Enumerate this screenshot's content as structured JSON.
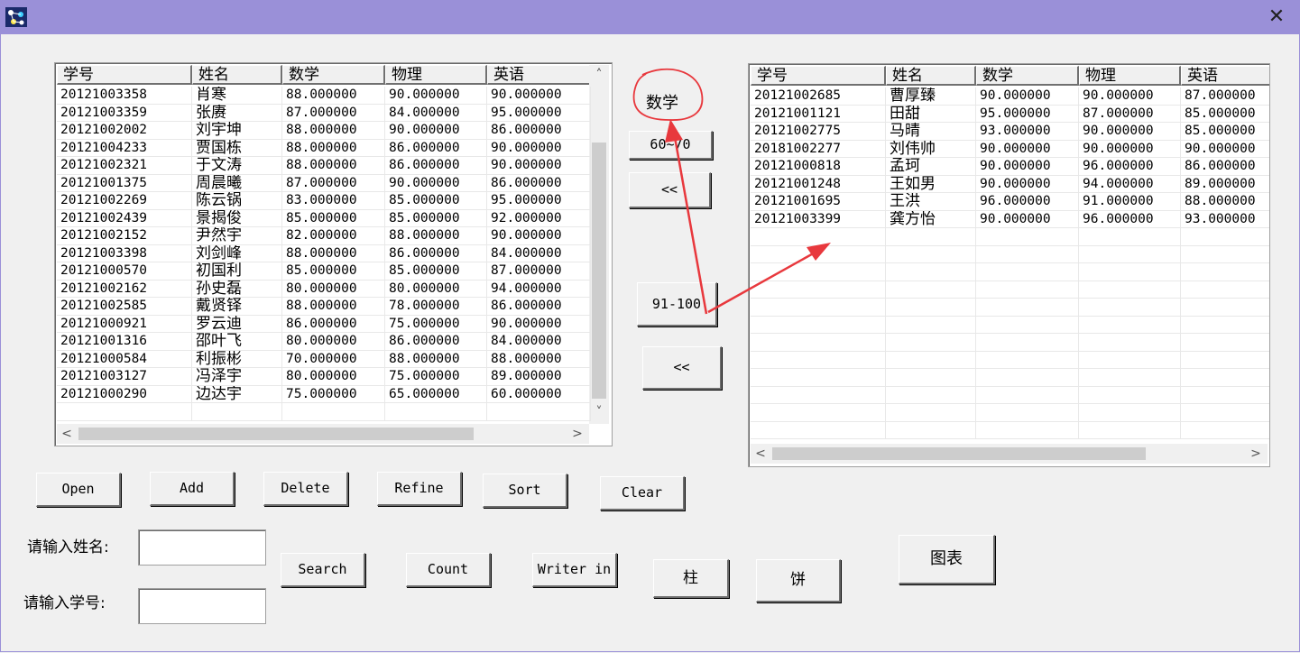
{
  "window": {
    "close_glyph": "✕",
    "icon": "app-molecule-icon"
  },
  "left_table": {
    "columns": [
      "学号",
      "姓名",
      "数学",
      "物理",
      "英语"
    ],
    "rows": [
      [
        "20121003358",
        "肖寒",
        "88.000000",
        "90.000000",
        "90.000000"
      ],
      [
        "20121003359",
        "张赓",
        "87.000000",
        "84.000000",
        "95.000000"
      ],
      [
        "20121002002",
        "刘宇坤",
        "88.000000",
        "90.000000",
        "86.000000"
      ],
      [
        "20121004233",
        "贾国栋",
        "88.000000",
        "86.000000",
        "90.000000"
      ],
      [
        "20121002321",
        "于文涛",
        "88.000000",
        "86.000000",
        "90.000000"
      ],
      [
        "20121001375",
        "周晨曦",
        "87.000000",
        "90.000000",
        "86.000000"
      ],
      [
        "20121002269",
        "陈云锅",
        "83.000000",
        "85.000000",
        "95.000000"
      ],
      [
        "20121002439",
        "景揭俊",
        "85.000000",
        "85.000000",
        "92.000000"
      ],
      [
        "20121002152",
        "尹然宇",
        "82.000000",
        "88.000000",
        "90.000000"
      ],
      [
        "20121003398",
        "刘剑峰",
        "88.000000",
        "86.000000",
        "84.000000"
      ],
      [
        "20121000570",
        "初国利",
        "85.000000",
        "85.000000",
        "87.000000"
      ],
      [
        "20121002162",
        "孙史磊",
        "80.000000",
        "80.000000",
        "94.000000"
      ],
      [
        "20121002585",
        "戴贤铎",
        "88.000000",
        "78.000000",
        "86.000000"
      ],
      [
        "20121000921",
        "罗云迪",
        "86.000000",
        "75.000000",
        "90.000000"
      ],
      [
        "20121001316",
        "邵叶飞",
        "80.000000",
        "86.000000",
        "84.000000"
      ],
      [
        "20121000584",
        "利振彬",
        "70.000000",
        "88.000000",
        "88.000000"
      ],
      [
        "20121003127",
        "冯泽宇",
        "80.000000",
        "75.000000",
        "89.000000"
      ],
      [
        "20121000290",
        "边达宇",
        "75.000000",
        "65.000000",
        "60.000000"
      ]
    ],
    "scroll_up": "˄",
    "scroll_down": "˅",
    "scroll_left": "<",
    "scroll_right": ">"
  },
  "right_table": {
    "columns": [
      "学号",
      "姓名",
      "数学",
      "物理",
      "英语"
    ],
    "rows": [
      [
        "20121002685",
        "曹厚臻",
        "90.000000",
        "90.000000",
        "87.000000"
      ],
      [
        "20121001121",
        "田甜",
        "95.000000",
        "87.000000",
        "85.000000"
      ],
      [
        "20121002775",
        "马晴",
        "93.000000",
        "90.000000",
        "85.000000"
      ],
      [
        "20181002277",
        "刘伟帅",
        "90.000000",
        "90.000000",
        "90.000000"
      ],
      [
        "20121000818",
        "孟珂",
        "90.000000",
        "96.000000",
        "86.000000"
      ],
      [
        "20121001248",
        "王如男",
        "90.000000",
        "94.000000",
        "89.000000"
      ],
      [
        "20121001695",
        "王洪",
        "96.000000",
        "91.000000",
        "88.000000"
      ],
      [
        "20121003399",
        "龚方怡",
        "90.000000",
        "96.000000",
        "93.000000"
      ]
    ],
    "scroll_left": "<",
    "scroll_right": ">"
  },
  "middle": {
    "annotation_label": "数学",
    "range_60_70": "60~70",
    "back1": "<<",
    "range_91_100": "91-100",
    "back2": "<<"
  },
  "buttons": {
    "open": "Open",
    "add": "Add",
    "delete": "Delete",
    "refine": "Refine",
    "sort": "Sort",
    "clear": "Clear",
    "search": "Search",
    "count": "Count",
    "writer_in": "Writer in",
    "bar": "柱",
    "pie": "饼",
    "chart": "图表"
  },
  "labels": {
    "name_prompt": "请输入姓名:",
    "id_prompt": "请输入学号:"
  },
  "inputs": {
    "name_value": "",
    "id_value": ""
  },
  "colors": {
    "titlebar": "#9a90d8",
    "annotation": "#e8383d"
  }
}
